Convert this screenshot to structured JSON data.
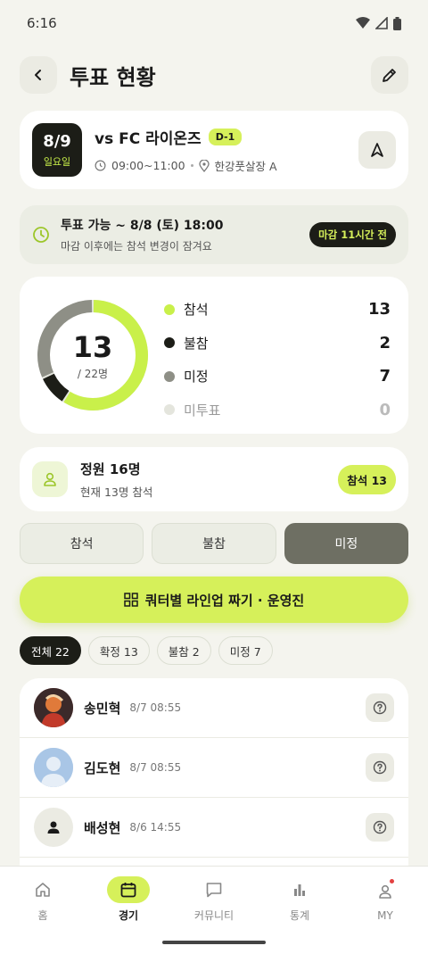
{
  "status_bar": {
    "time": "6:16"
  },
  "header": {
    "title": "투표 현황"
  },
  "match": {
    "date": "8/9",
    "weekday": "일요일",
    "opponent": "vs FC 라이온즈",
    "dday": "D-1",
    "time": "09:00~11:00",
    "location": "한강풋살장 A"
  },
  "deadline": {
    "title": "투표 가능 ~ 8/8 (토) 18:00",
    "subtitle": "마감 이후에는 참석 변경이 잠겨요",
    "badge": "마감 11시간 전"
  },
  "summary": {
    "total_voted": "13",
    "total_sub": "/ 22명",
    "items": [
      {
        "label": "참석",
        "value": "13",
        "color": "#c9f04a"
      },
      {
        "label": "불참",
        "value": "2",
        "color": "#1c1d17"
      },
      {
        "label": "미정",
        "value": "7",
        "color": "#8e8f86"
      },
      {
        "label": "미투표",
        "value": "0",
        "color": "#e4e5dd"
      }
    ]
  },
  "chart_data": {
    "type": "pie",
    "categories": [
      "참석",
      "불참",
      "미정",
      "미투표"
    ],
    "values": [
      13,
      2,
      7,
      0
    ]
  },
  "capacity": {
    "title": "정원 16명",
    "subtitle": "현재 13명 참석",
    "badge": "참석 13"
  },
  "vote_options": [
    {
      "label": "참석",
      "active": false
    },
    {
      "label": "불참",
      "active": false
    },
    {
      "label": "미정",
      "active": true
    }
  ],
  "lineup_button": {
    "label": "쿼터별 라인업 짜기 · 운영진"
  },
  "filters": [
    {
      "label": "전체 22",
      "active": true
    },
    {
      "label": "확정 13",
      "active": false
    },
    {
      "label": "불참 2",
      "active": false
    },
    {
      "label": "미정 7",
      "active": false
    }
  ],
  "members": [
    {
      "name": "송민혁",
      "time": "8/7 08:55",
      "avatar": "photo",
      "status_icon": "question-icon"
    },
    {
      "name": "김도현",
      "time": "8/7 08:55",
      "avatar": "default-photo",
      "status_icon": "question-icon"
    },
    {
      "name": "배성현",
      "time": "8/6 14:55",
      "avatar": "person-icon",
      "status_icon": "question-icon"
    }
  ],
  "bottom_nav": [
    {
      "label": "홈",
      "icon": "home-icon",
      "active": false
    },
    {
      "label": "경기",
      "icon": "calendar-icon",
      "active": true
    },
    {
      "label": "커뮤니티",
      "icon": "chat-icon",
      "active": false
    },
    {
      "label": "통계",
      "icon": "bar-chart-icon",
      "active": false
    },
    {
      "label": "MY",
      "icon": "user-icon",
      "active": false
    }
  ]
}
